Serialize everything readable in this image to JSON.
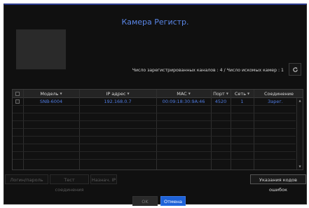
{
  "dialog": {
    "title": "Камера Регистр."
  },
  "summary": {
    "text": "Число зарегистрированных каналов : 4 / Число искомых камер : 1"
  },
  "table": {
    "headers": [
      "Модель",
      "IP адрес",
      "MAC",
      "Порт",
      "Сеть",
      "Соединение"
    ],
    "rows": [
      {
        "model": "SNB-6004",
        "ip": "192.168.0.7",
        "mac": "00:09:18:30:9A:46",
        "port": "4520",
        "net": "1",
        "connection": "Зарег."
      }
    ]
  },
  "actions": {
    "login": "Логин/пароль",
    "test": "Тест соединения",
    "assign_ip": "Назнач. IP",
    "error_codes": "Указания кодов ошибок"
  },
  "footer": {
    "ok": "OK",
    "cancel": "Отмена"
  },
  "colors": {
    "accent": "#1e62d8",
    "title": "#5a86e6",
    "row_text": "#4f7be0"
  }
}
